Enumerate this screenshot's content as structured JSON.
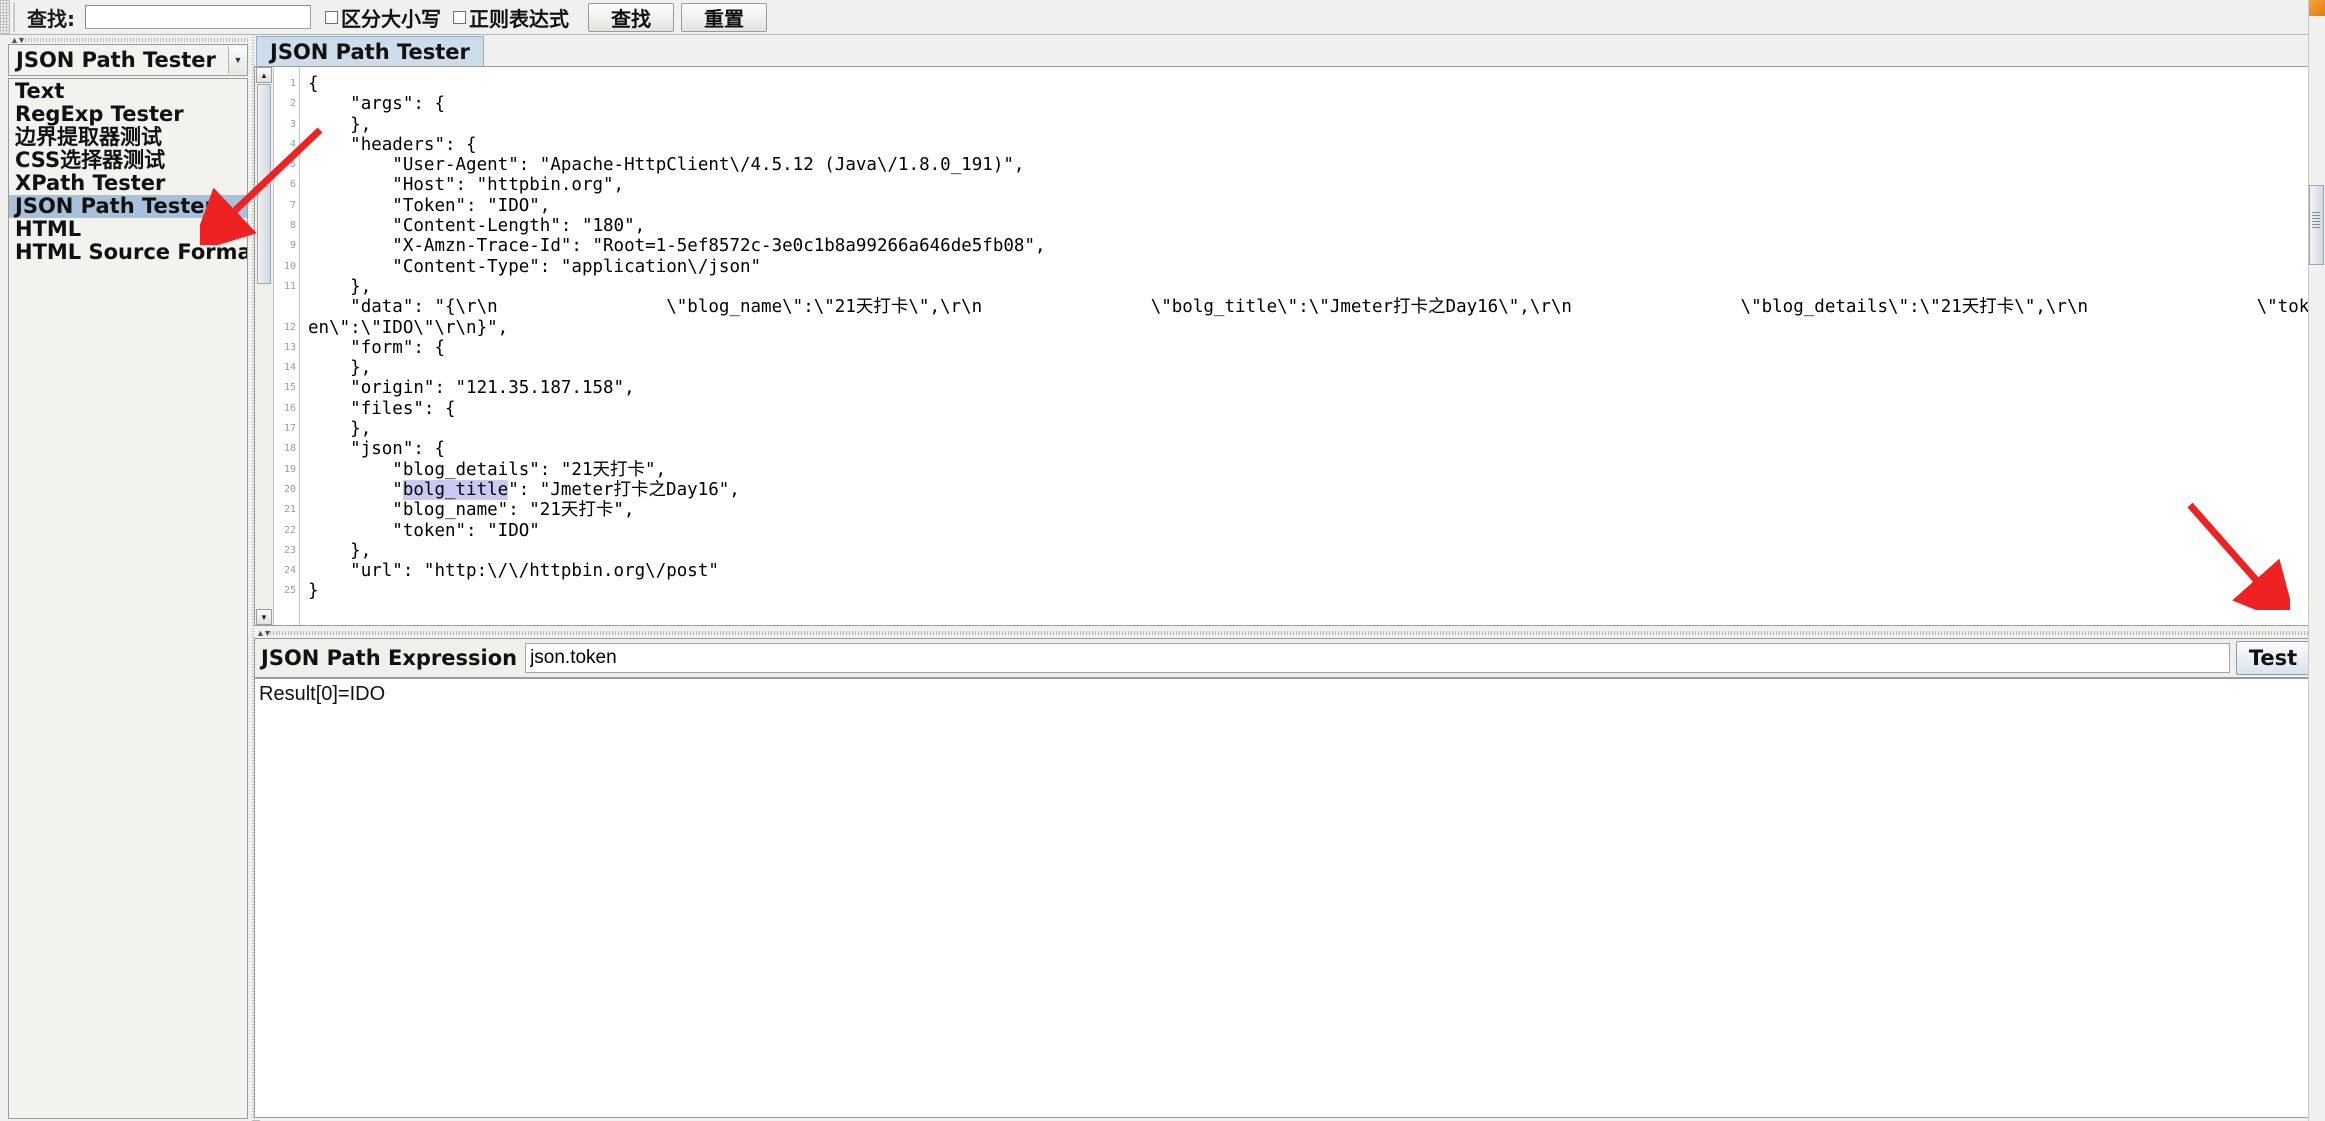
{
  "toolbar": {
    "find_label": "查找:",
    "find_value": "",
    "find_placeholder": "",
    "case_sensitive_label": "区分大小写",
    "regex_label": "正则表达式",
    "find_button": "查找",
    "reset_button": "重置"
  },
  "sidebar": {
    "combo_value": "JSON Path Tester",
    "items": [
      {
        "label": "Text",
        "selected": false
      },
      {
        "label": "RegExp Tester",
        "selected": false
      },
      {
        "label": "边界提取器测试",
        "selected": false
      },
      {
        "label": "CSS选择器测试",
        "selected": false
      },
      {
        "label": "XPath Tester",
        "selected": false
      },
      {
        "label": "JSON Path Tester",
        "selected": true
      },
      {
        "label": "HTML",
        "selected": false
      },
      {
        "label": "HTML Source Formatted",
        "selected": false
      }
    ]
  },
  "main": {
    "tab_label": "JSON Path Tester",
    "code_lines": [
      {
        "n": "1",
        "text": "{"
      },
      {
        "n": "2",
        "text": "    \"args\": {"
      },
      {
        "n": "3",
        "text": "    },"
      },
      {
        "n": "4",
        "text": "    \"headers\": {"
      },
      {
        "n": "5",
        "text": "        \"User-Agent\": \"Apache-HttpClient\\/4.5.12 (Java\\/1.8.0_191)\","
      },
      {
        "n": "6",
        "text": "        \"Host\": \"httpbin.org\","
      },
      {
        "n": "7",
        "text": "        \"Token\": \"IDO\","
      },
      {
        "n": "8",
        "text": "        \"Content-Length\": \"180\","
      },
      {
        "n": "9",
        "text": "        \"X-Amzn-Trace-Id\": \"Root=1-5ef8572c-3e0c1b8a99266a646de5fb08\","
      },
      {
        "n": "10",
        "text": "        \"Content-Type\": \"application\\/json\""
      },
      {
        "n": "11",
        "text": "    },"
      },
      {
        "n": "12",
        "text": "    \"data\": \"{\\r\\n                \\\"blog_name\\\":\\\"21天打卡\\\",\\r\\n                \\\"bolg_title\\\":\\\"Jmeter打卡之Day16\\\",\\r\\n                \\\"blog_details\\\":\\\"21天打卡\\\",\\r\\n                \\\"token\\\":\\\"IDO\\\"\\r\\n}\",",
        "wrapped": true
      },
      {
        "n": "13",
        "text": "    \"form\": {"
      },
      {
        "n": "14",
        "text": "    },"
      },
      {
        "n": "15",
        "text": "    \"origin\": \"121.35.187.158\","
      },
      {
        "n": "16",
        "text": "    \"files\": {"
      },
      {
        "n": "17",
        "text": "    },"
      },
      {
        "n": "18",
        "text": "    \"json\": {"
      },
      {
        "n": "19",
        "text": "        \"blog_details\": \"21天打卡\","
      },
      {
        "n": "20",
        "text": "        \"bolg_title\": \"Jmeter打卡之Day16\",",
        "highlight": "bolg_title"
      },
      {
        "n": "21",
        "text": "        \"blog_name\": \"21天打卡\","
      },
      {
        "n": "22",
        "text": "        \"token\": \"IDO\""
      },
      {
        "n": "23",
        "text": "    },"
      },
      {
        "n": "24",
        "text": "    \"url\": \"http:\\/\\/httpbin.org\\/post\""
      },
      {
        "n": "25",
        "text": "}"
      }
    ]
  },
  "expression_panel": {
    "label": "JSON Path Expression",
    "value": "json.token",
    "placeholder": "",
    "test_button": "Test",
    "result": "Result[0]=IDO"
  },
  "colors": {
    "selection_blue": "#a7c0dc",
    "tab_blue": "#cddcea",
    "text_highlight": "#c9c9f2",
    "annotation_red": "#ee2222"
  },
  "icons": {
    "combo_arrow": "▼",
    "scroll_up": "▲",
    "scroll_down": "▼",
    "split_up": "▲",
    "split_down": "▼"
  }
}
